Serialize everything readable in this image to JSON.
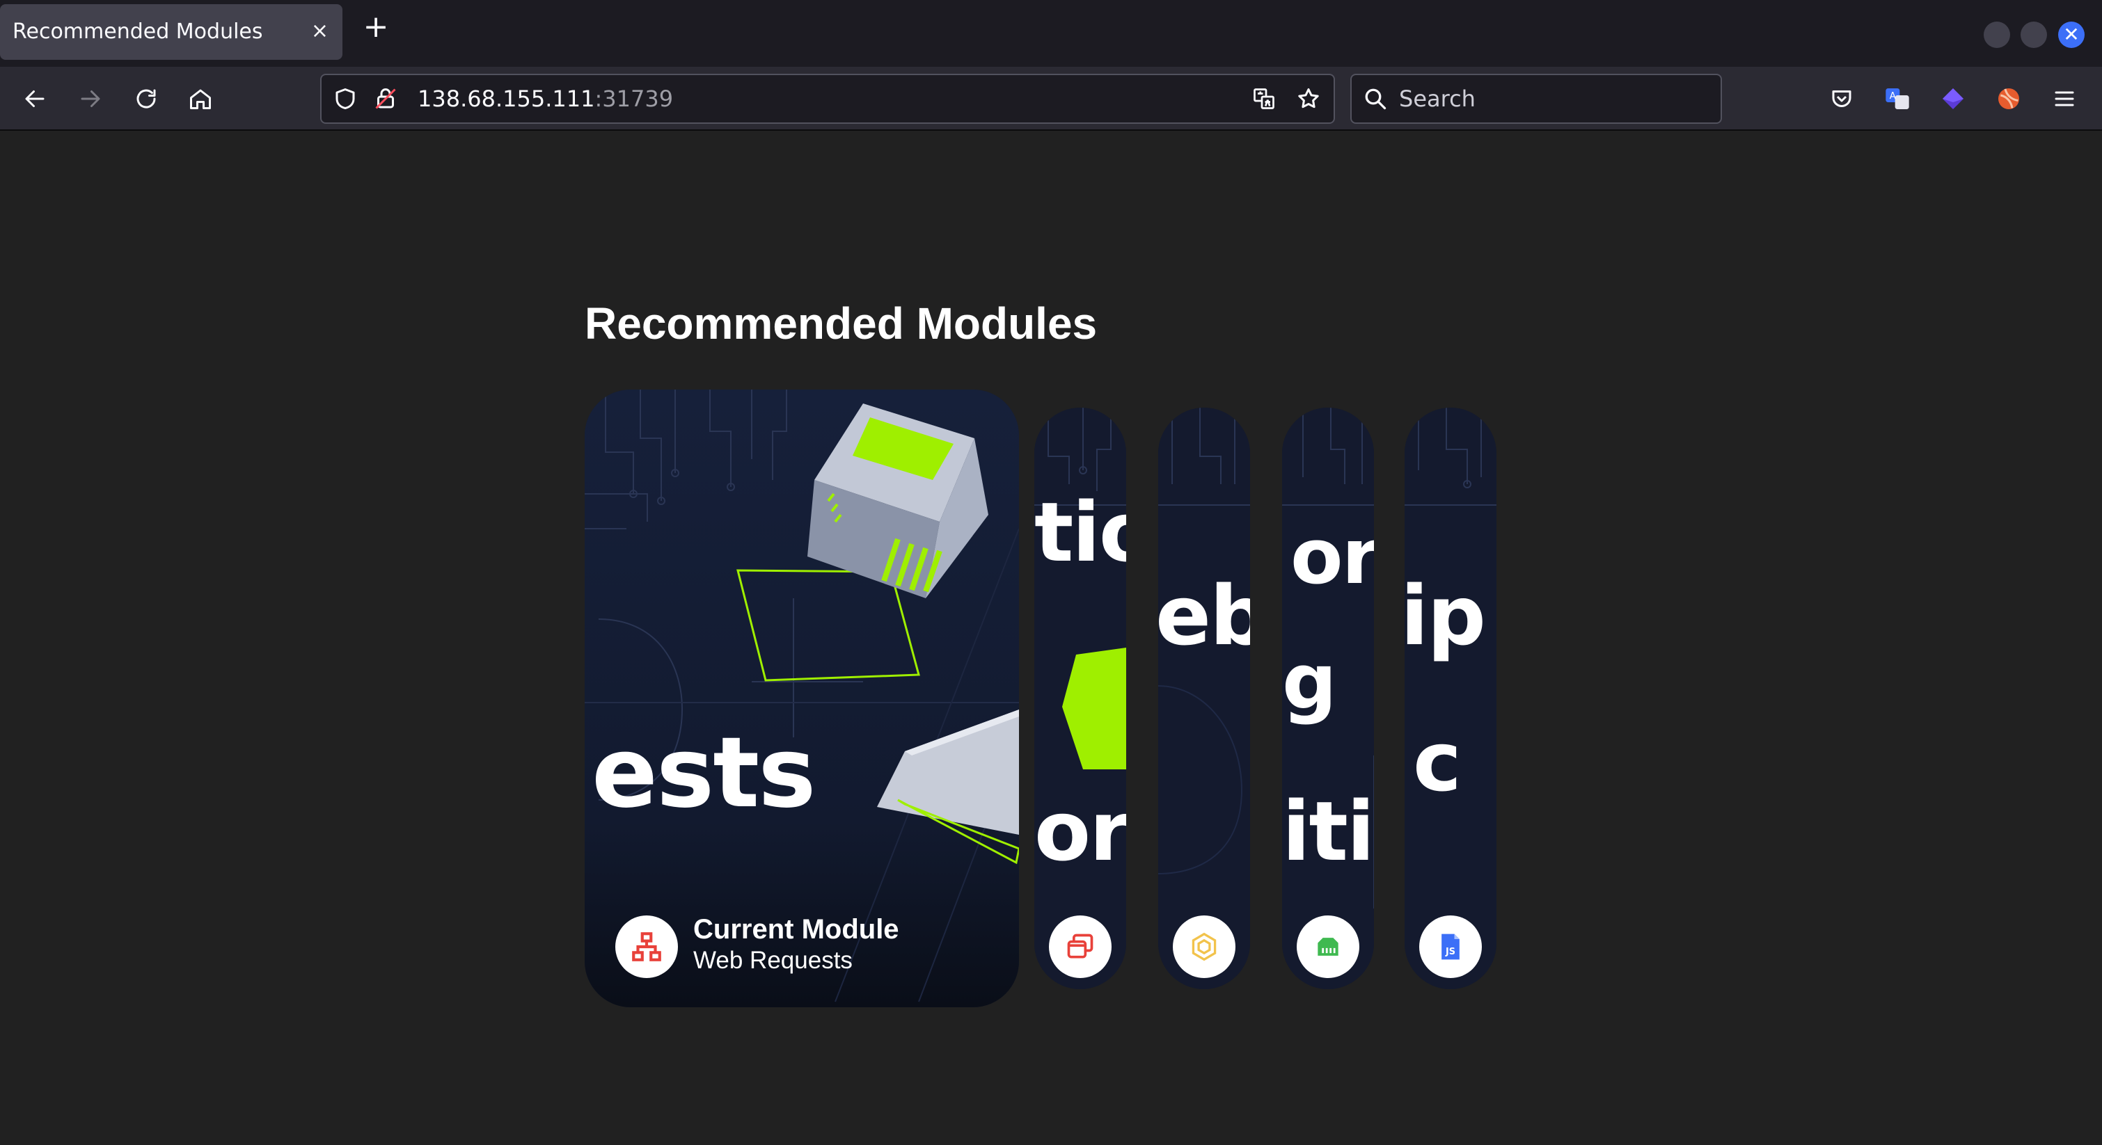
{
  "browser": {
    "tab": {
      "title": "Recommended Modules",
      "close_glyph": "×"
    },
    "new_tab_glyph": "+",
    "url": {
      "host": "138.68.155.111",
      "port": ":31739"
    },
    "search": {
      "placeholder": "Search"
    }
  },
  "page": {
    "title": "Recommended Modules",
    "featured": {
      "fragment": "ests",
      "caption_title": "Current Module",
      "caption_subtitle": "Web Requests",
      "icon": "network-icon"
    },
    "collapsed_cards": [
      {
        "line1": "tio",
        "line2": "or",
        "icon": "windows-stack-icon",
        "accent": "#e8413a"
      },
      {
        "line1": "eb",
        "line2": "",
        "icon": "hexagon-icon",
        "accent": "#f2c34c"
      },
      {
        "line1": "or",
        "line2": "g",
        "line3": "iti",
        "icon": "server-rack-icon",
        "accent": "#3fb950"
      },
      {
        "line1": "ip",
        "line2": "c",
        "icon": "js-file-icon",
        "accent": "#3c6ff7"
      }
    ]
  },
  "colors": {
    "page_bg": "#212121",
    "card_bg": "#141a2e",
    "accent_green": "#9fef00"
  }
}
